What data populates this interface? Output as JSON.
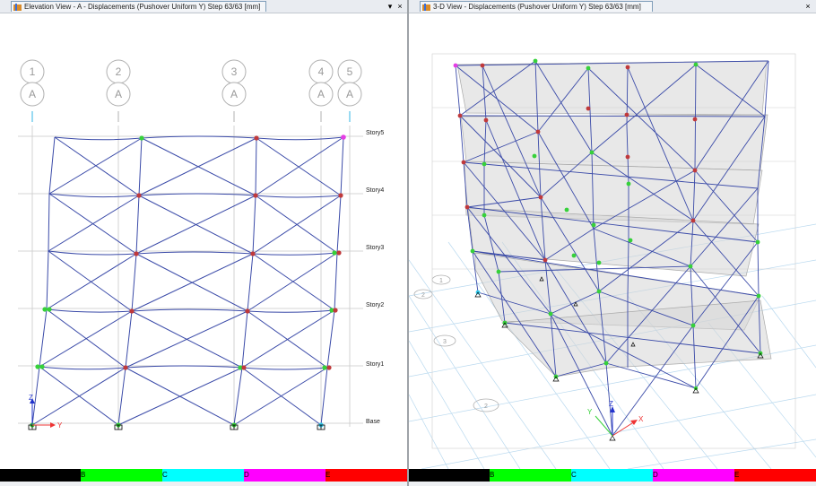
{
  "left_view": {
    "title": "Elevation View - A  - Displacements (Pushover Uniform Y)  Step 63/63  [mm]",
    "dropdown_glyph": "▾",
    "close_glyph": "×",
    "grid_numbers": [
      "1",
      "2",
      "3",
      "4",
      "5"
    ],
    "grid_letters": [
      "A",
      "A",
      "A",
      "A",
      "A"
    ],
    "story_labels": [
      "Story5",
      "Story4",
      "Story3",
      "Story2",
      "Story1",
      "Base"
    ],
    "axis_labels": {
      "z": "Z",
      "y": "Y"
    }
  },
  "right_view": {
    "title": "3-D View  - Displacements (Pushover Uniform Y)  Step 63/63  [mm]",
    "close_glyph": "×",
    "axis_labels": {
      "z": "Z",
      "y": "Y",
      "x": "X"
    },
    "floor_grid_labels": [
      "1",
      "3",
      "2",
      "2"
    ]
  },
  "legend": {
    "segments": [
      {
        "label": "",
        "color": "#000000"
      },
      {
        "label": "B",
        "color": "#00ff00"
      },
      {
        "label": "C",
        "color": "#00ffff"
      },
      {
        "label": "D",
        "color": "#ff00ff"
      },
      {
        "label": "E",
        "color": "#ff0000"
      }
    ]
  },
  "colors": {
    "frame": "#3a4aa8",
    "hinge_green": "#36d13a",
    "hinge_red": "#c0393b",
    "hinge_magenta": "#e43de4",
    "hinge_cyan": "#33ccee",
    "gridline": "#bcbcbc"
  },
  "icons": [
    "view-icon",
    "dropdown-icon",
    "close-icon",
    "restraint-icon"
  ]
}
